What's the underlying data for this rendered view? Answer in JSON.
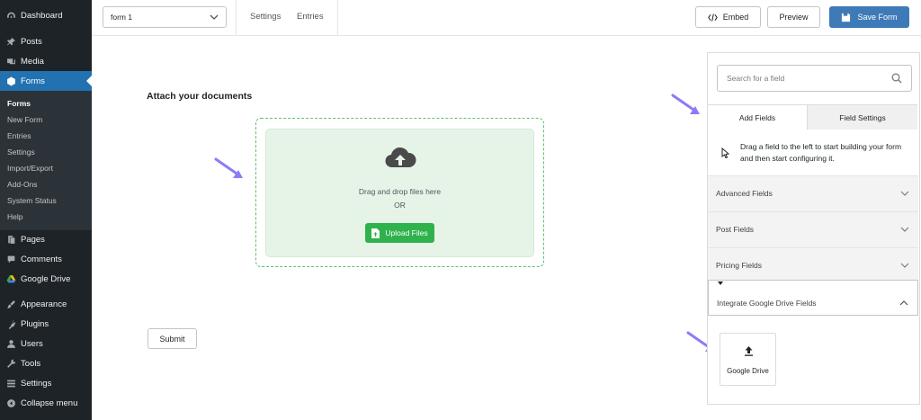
{
  "sidebar": {
    "top_items": [
      {
        "label": "Dashboard",
        "icon": "dashboard-icon"
      },
      {
        "label": "Posts",
        "icon": "pin-icon"
      },
      {
        "label": "Media",
        "icon": "media-icon"
      },
      {
        "label": "Forms",
        "icon": "forms-icon"
      }
    ],
    "submenu": [
      "Forms",
      "New Form",
      "Entries",
      "Settings",
      "Import/Export",
      "Add-Ons",
      "System Status",
      "Help"
    ],
    "bottom_items": [
      {
        "label": "Pages",
        "icon": "pages-icon"
      },
      {
        "label": "Comments",
        "icon": "comments-icon"
      },
      {
        "label": "Google Drive",
        "icon": "google-drive-icon"
      },
      {
        "label": "Appearance",
        "icon": "brush-icon"
      },
      {
        "label": "Plugins",
        "icon": "plugin-icon"
      },
      {
        "label": "Users",
        "icon": "users-icon"
      },
      {
        "label": "Tools",
        "icon": "wrench-icon"
      },
      {
        "label": "Settings",
        "icon": "settings-icon"
      },
      {
        "label": "Collapse menu",
        "icon": "collapse-icon"
      }
    ],
    "active_color": "#2271b1"
  },
  "topbar": {
    "form_select": "form 1",
    "links": [
      "Settings",
      "Entries"
    ],
    "embed_label": "Embed",
    "preview_label": "Preview",
    "save_label": "Save Form"
  },
  "canvas": {
    "form_title": "Attach your documents",
    "drop_text": "Drag and drop files here",
    "or_text": "OR",
    "upload_label": "Upload Files",
    "submit_label": "Submit",
    "accent_green": "#2fb24c"
  },
  "panel": {
    "search_placeholder": "Search for a field",
    "tabs": [
      "Add Fields",
      "Field Settings"
    ],
    "hint": "Drag a field to the left to start building your form and then start configuring it.",
    "sections": [
      "Advanced Fields",
      "Post Fields",
      "Pricing Fields",
      "Integrate Google Drive Fields"
    ],
    "field_card_label": "Google Drive",
    "arrow_color": "#8b7cf6"
  }
}
